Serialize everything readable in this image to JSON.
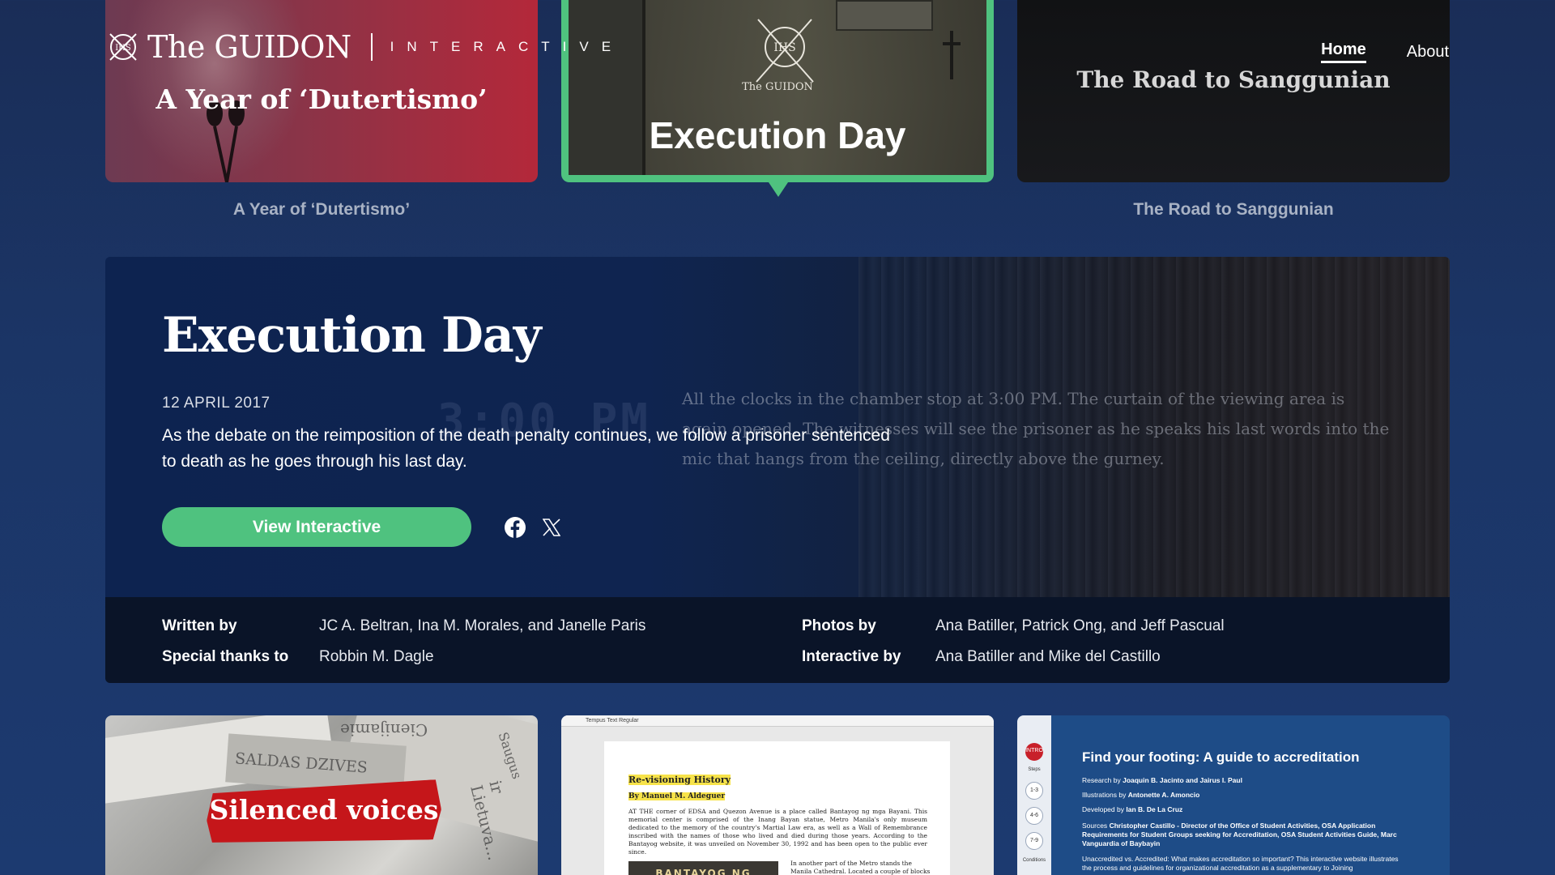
{
  "header": {
    "brand_name": "The GUIDON",
    "brand_sub": "INTERACTIVE",
    "nav": [
      {
        "label": "Home",
        "active": true
      },
      {
        "label": "About",
        "active": false
      }
    ]
  },
  "carousel": {
    "cards": [
      {
        "title": "A Year of ‘Dutertismo’",
        "caption": "A Year of ‘Dutertismo’"
      },
      {
        "title": "Execution Day",
        "seal_text": "The GUIDON",
        "active": true
      },
      {
        "title": "The Road to Sanggunian",
        "caption": "The Road to Sanggunian"
      }
    ]
  },
  "feature": {
    "title": "Execution Day",
    "date": "12 APRIL 2017",
    "description": "As the debate on the reimposition of the death penalty continues, we follow a prisoner sentenced to death as he goes through his last day.",
    "button_label": "View Interactive",
    "background_clock": "3:00 PM",
    "background_text": "All the clocks in the chamber stop at 3:00 PM. The curtain of the viewing area is again opened. The witnesses will see the prisoner as he speaks his last words into the mic that hangs from the ceiling, directly above the gurney.",
    "share": [
      {
        "icon": "facebook-icon"
      },
      {
        "icon": "x-icon"
      }
    ],
    "credits": {
      "written_by_label": "Written by",
      "written_by": "JC A. Beltran, Ina M. Morales, and Janelle Paris",
      "special_thanks_label": "Special thanks to",
      "special_thanks": "Robbin M. Dagle",
      "photos_by_label": "Photos by",
      "photos_by": "Ana Batiller, Patrick Ong, and Jeff Pascual",
      "interactive_by_label": "Interactive by",
      "interactive_by": "Ana Batiller and Mike del Castillo"
    }
  },
  "bottom": {
    "silenced": {
      "title": "Silenced voices",
      "paper_words": [
        "SALDAS DZIVES",
        "Cienijamie",
        "ir Lietuva...",
        "Saugus"
      ]
    },
    "revisioning": {
      "toolbar": "Tempus Text   Regular",
      "heading": "Re-visioning History",
      "byline": "By Manuel M. Aldeguer",
      "paragraph": "AT THE corner of EDSA and Quezon Avenue is a place called Bantayog ng mga Bayani. This memorial center is comprised of the Inang Bayan statue, Metro Manila's only museum dedicated to the memory of the country's Martial Law era, as well as a Wall of Remembrance inscribed with the names of those who lived and died during those years. According to the Bantayog website, it was unveiled on November 30, 1992 and has been open to the public ever since.",
      "image_text": "BANTAYOG NG",
      "paragraph2": "In another part of the Metro stands the Manila Cathedral. Located a couple of blocks behind"
    },
    "accreditation": {
      "title": "Find your footing: A guide to accreditation",
      "research_label": "Research by",
      "research": "Joaquin B. Jacinto and Jairus I. Paul",
      "illustrations_label": "Illustrations by",
      "illustrations": "Antonette A. Amoncio",
      "developed_label": "Developed by",
      "developed": "Ian B. De La Cruz",
      "sources_label": "Sources",
      "sources": "Christopher Castillo - Director of the Office of Student Activities, OSA Application Requirements for Student Groups seeking for Accreditation, OSA Student Activities Guide, Marc Vanguardia of Baybayin",
      "body": "Unaccredited vs. Accredited: What makes accreditation so important? This interactive website illustrates the process and guidelines for organizational accreditation as a supplementary to Joining",
      "rail": {
        "intro": "INTRO",
        "steps_label": "Steps",
        "steps": [
          "1-3",
          "4-6",
          "7-9"
        ],
        "conditions_label": "Conditions"
      }
    }
  },
  "colors": {
    "accent": "#4fc27f",
    "background": "#1b3566",
    "credits_bg": "#0a1428",
    "silenced_red": "#c5161a"
  }
}
